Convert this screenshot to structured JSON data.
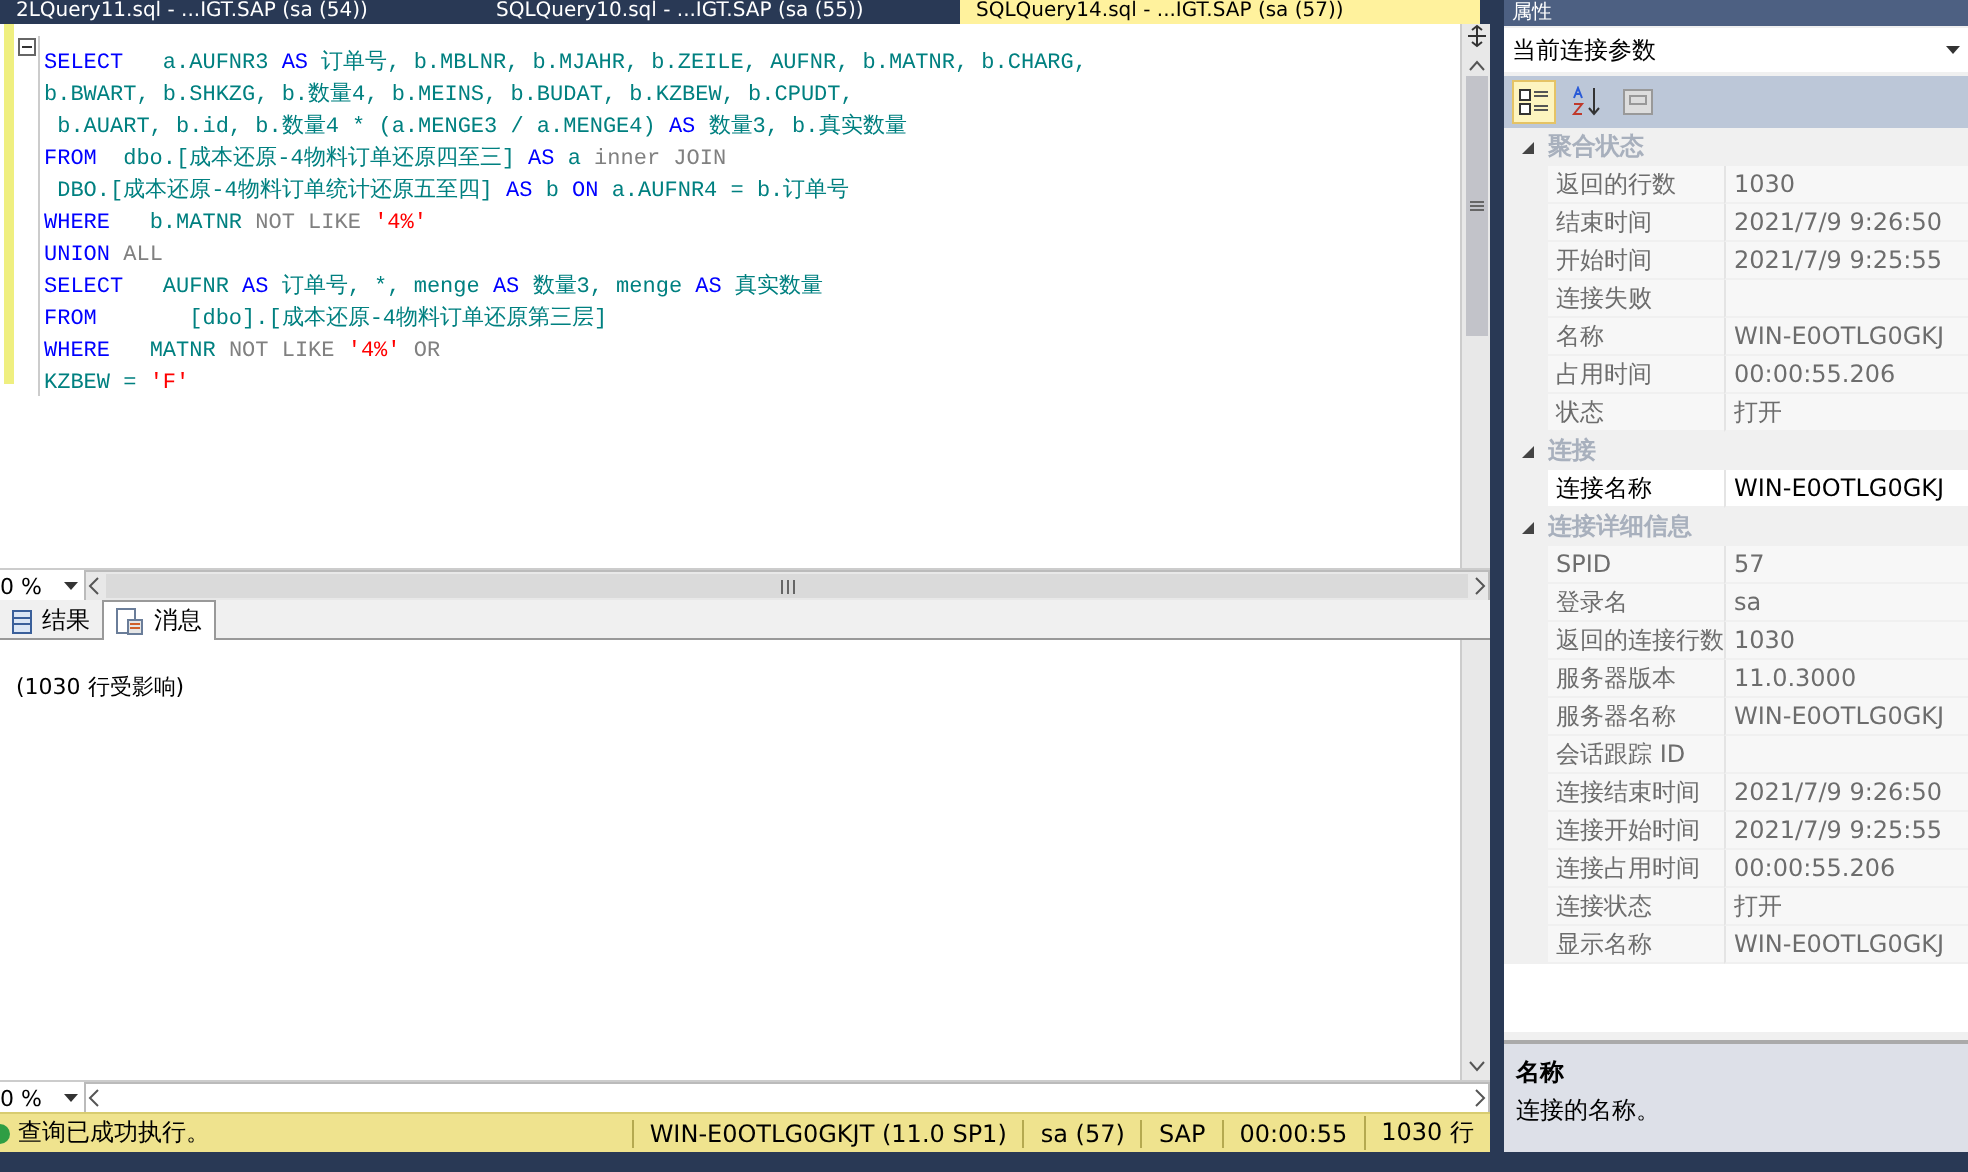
{
  "doc_tabs": [
    {
      "label": "2LQuery11.sql - ...IGT.SAP (sa (54))",
      "selected": false
    },
    {
      "label": "SQLQuery10.sql - ...IGT.SAP (sa (55))",
      "selected": false
    },
    {
      "label": "SQLQuery14.sql - ...IGT.SAP (sa (57))",
      "selected": true
    }
  ],
  "editor": {
    "lines": [
      [
        {
          "kind": "kw",
          "text": "SELECT"
        },
        {
          "kind": "id",
          "text": "   a.AUFNR3 "
        },
        {
          "kind": "kw",
          "text": "AS"
        },
        {
          "kind": "id",
          "text": " 订单号, b.MBLNR, b.MJAHR, b.ZEILE, AUFNR, b.MATNR, b.CHARG,"
        }
      ],
      [
        {
          "kind": "id",
          "text": "b.BWART, b.SHKZG, b.数量4, b.MEINS, b.BUDAT, b.KZBEW, b.CPUDT,"
        }
      ],
      [
        {
          "kind": "id",
          "text": " b.AUART, b.id, b.数量4 * (a.MENGE3 / a.MENGE4) "
        },
        {
          "kind": "kw",
          "text": "AS"
        },
        {
          "kind": "id",
          "text": " 数量3, b.真实数量"
        }
      ],
      [
        {
          "kind": "kw",
          "text": "FROM"
        },
        {
          "kind": "id",
          "text": "  dbo.[成本还原-4物料订单还原四至三] "
        },
        {
          "kind": "kw",
          "text": "AS"
        },
        {
          "kind": "id",
          "text": " a "
        },
        {
          "kind": "op",
          "text": "inner JOIN"
        }
      ],
      [
        {
          "kind": "id",
          "text": " DBO.[成本还原-4物料订单统计还原五至四] "
        },
        {
          "kind": "kw",
          "text": "AS"
        },
        {
          "kind": "id",
          "text": " b "
        },
        {
          "kind": "kw",
          "text": "ON"
        },
        {
          "kind": "id",
          "text": " a.AUFNR4 = b.订单号"
        }
      ],
      [
        {
          "kind": "kw",
          "text": "WHERE"
        },
        {
          "kind": "id",
          "text": "   b.MATNR "
        },
        {
          "kind": "op",
          "text": "NOT LIKE "
        },
        {
          "kind": "str",
          "text": "'4%'"
        }
      ],
      [
        {
          "kind": "kw",
          "text": "UNION"
        },
        {
          "kind": "op",
          "text": " ALL"
        }
      ],
      [
        {
          "kind": "kw",
          "text": "SELECT"
        },
        {
          "kind": "id",
          "text": "   AUFNR "
        },
        {
          "kind": "kw",
          "text": "AS"
        },
        {
          "kind": "id",
          "text": " 订单号, *, menge "
        },
        {
          "kind": "kw",
          "text": "AS"
        },
        {
          "kind": "id",
          "text": " 数量3, menge "
        },
        {
          "kind": "kw",
          "text": "AS"
        },
        {
          "kind": "id",
          "text": " 真实数量"
        }
      ],
      [
        {
          "kind": "kw",
          "text": "FROM"
        },
        {
          "kind": "id",
          "text": "       [dbo].[成本还原-4物料订单还原第三层]"
        }
      ],
      [
        {
          "kind": "kw",
          "text": "WHERE"
        },
        {
          "kind": "id",
          "text": "   MATNR "
        },
        {
          "kind": "op",
          "text": "NOT LIKE "
        },
        {
          "kind": "str",
          "text": "'4%'"
        },
        {
          "kind": "op",
          "text": " OR"
        }
      ],
      [
        {
          "kind": "id",
          "text": "KZBEW = "
        },
        {
          "kind": "str",
          "text": "'F'"
        }
      ]
    ],
    "zoom": "0 %"
  },
  "result_tabs": [
    {
      "label": "结果",
      "selected": false
    },
    {
      "label": "消息",
      "selected": true
    }
  ],
  "messages": [
    "(1030 行受影响)"
  ],
  "results_zoom": "0 %",
  "status_bar": {
    "message": "查询已成功执行。",
    "server": "WIN-E0OTLG0GKJT (11.0 SP1)",
    "user": "sa (57)",
    "database": "SAP",
    "elapsed": "00:00:55",
    "rows": "1030 行"
  },
  "properties": {
    "title": "属性",
    "object": "当前连接参数",
    "categories": [
      {
        "name": "聚合状态",
        "expanded": true,
        "items": [
          {
            "name": "返回的行数",
            "value": "1030",
            "selected": false
          },
          {
            "name": "结束时间",
            "value": "2021/7/9 9:26:50",
            "selected": false
          },
          {
            "name": "开始时间",
            "value": "2021/7/9 9:25:55",
            "selected": false
          },
          {
            "name": "连接失败",
            "selected": false
          },
          {
            "name": "名称",
            "value": "WIN-E0OTLG0GKJ",
            "selected": false
          },
          {
            "name": "占用时间",
            "value": "00:00:55.206",
            "selected": false
          },
          {
            "name": "状态",
            "value": "打开",
            "selected": false
          }
        ]
      },
      {
        "name": "连接",
        "expanded": true,
        "items": [
          {
            "name": "连接名称",
            "value": "WIN-E0OTLG0GKJ",
            "selected": true
          }
        ]
      },
      {
        "name": "连接详细信息",
        "expanded": true,
        "items": [
          {
            "name": "SPID",
            "value": "57",
            "selected": false
          },
          {
            "name": "登录名",
            "value": "sa",
            "selected": false
          },
          {
            "name": "返回的连接行数",
            "value": "1030",
            "selected": false
          },
          {
            "name": "服务器版本",
            "value": "11.0.3000",
            "selected": false
          },
          {
            "name": "服务器名称",
            "value": "WIN-E0OTLG0GKJ",
            "selected": false
          },
          {
            "name": "会话跟踪 ID",
            "selected": false
          },
          {
            "name": "连接结束时间",
            "value": "2021/7/9 9:26:50",
            "selected": false
          },
          {
            "name": "连接开始时间",
            "value": "2021/7/9 9:25:55",
            "selected": false
          },
          {
            "name": "连接占用时间",
            "value": "00:00:55.206",
            "selected": false
          },
          {
            "name": "连接状态",
            "value": "打开",
            "selected": false
          },
          {
            "name": "显示名称",
            "value": "WIN-E0OTLG0GKJ",
            "selected": false
          }
        ]
      }
    ],
    "description": {
      "title": "名称",
      "text": "连接的名称。"
    }
  }
}
